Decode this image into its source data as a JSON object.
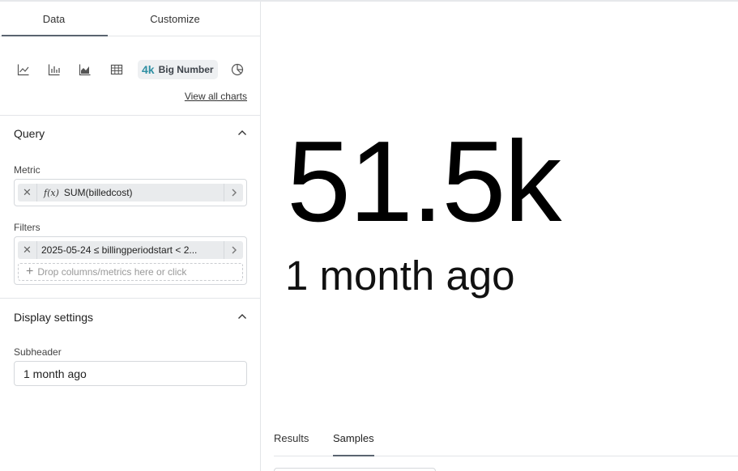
{
  "tabs": {
    "data": "Data",
    "customize": "Customize"
  },
  "chart_types": {
    "icons": [
      "line-chart-icon",
      "bar-chart-icon",
      "area-chart-icon",
      "table-icon",
      "pie-chart-icon"
    ],
    "big_number_glyph": "4k",
    "big_number_label": "Big Number",
    "view_all": "View all charts"
  },
  "query": {
    "title": "Query",
    "metric_label": "Metric",
    "metric_fx": "f(x)",
    "metric_value": "SUM(billedcost)",
    "filters_label": "Filters",
    "filter_value": "2025-05-24 ≤ billingperiodstart < 2...",
    "drop_placeholder": "Drop columns/metrics here or click"
  },
  "display": {
    "title": "Display settings",
    "subheader_label": "Subheader",
    "subheader_value": "1 month ago"
  },
  "result": {
    "big_number": "51.5k",
    "subheader": "1 month ago"
  },
  "bottom_tabs": {
    "results": "Results",
    "samples": "Samples"
  },
  "colors": {
    "accent": "#2f8fa3",
    "tab_indicator": "#5a6470",
    "border": "#e3e5e8"
  }
}
